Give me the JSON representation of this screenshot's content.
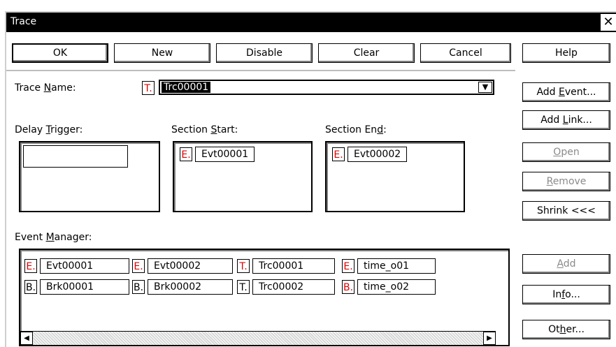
{
  "window": {
    "title": "Trace",
    "close_glyph": "✕"
  },
  "toolbar": {
    "ok": "OK",
    "new": "New",
    "disable": "Disable",
    "clear": "Clear",
    "cancel": "Cancel",
    "help": "Help"
  },
  "trace_name": {
    "label_pre": "Trace ",
    "label_u": "N",
    "label_post": "ame:",
    "tag": "T.",
    "value": "Trc00001"
  },
  "delay_trigger": {
    "label_pre": "Delay ",
    "label_u": "T",
    "label_post": "rigger:",
    "value": ""
  },
  "section_start": {
    "label_pre": "Section ",
    "label_u": "S",
    "label_post": "tart:",
    "tag": "E.",
    "event": "Evt00001"
  },
  "section_end": {
    "label_pre": "Section En",
    "label_u": "d",
    "label_post": ":",
    "tag": "E.",
    "event": "Evt00002"
  },
  "event_manager": {
    "label_pre": "Event ",
    "label_u": "M",
    "label_post": "anager:",
    "rows": [
      [
        {
          "tag": "E.",
          "name": "Evt00001",
          "red": true
        },
        {
          "tag": "E.",
          "name": "Evt00002",
          "red": true
        },
        {
          "tag": "T.",
          "name": "Trc00001",
          "red": true
        },
        {
          "tag": "E.",
          "name": "time_o01",
          "red": true
        }
      ],
      [
        {
          "tag": "B.",
          "name": "Brk00001",
          "red": false
        },
        {
          "tag": "B.",
          "name": "Brk00002",
          "red": false
        },
        {
          "tag": "T.",
          "name": "Trc00002",
          "red": false
        },
        {
          "tag": "B.",
          "name": "time_o02",
          "red": true
        }
      ]
    ]
  },
  "side_buttons": {
    "add_event_pre": "Add ",
    "add_event_u": "E",
    "add_event_post": "vent...",
    "add_link_pre": "Add ",
    "add_link_u": "L",
    "add_link_post": "ink...",
    "open_u": "O",
    "open_post": "pen",
    "remove_u": "R",
    "remove_post": "emove",
    "shrink": "Shrink <<<",
    "add_u": "A",
    "add_post": "dd",
    "info_pre": "In",
    "info_u": "f",
    "info_post": "o...",
    "other_pre": "Ot",
    "other_u": "h",
    "other_post": "er..."
  }
}
